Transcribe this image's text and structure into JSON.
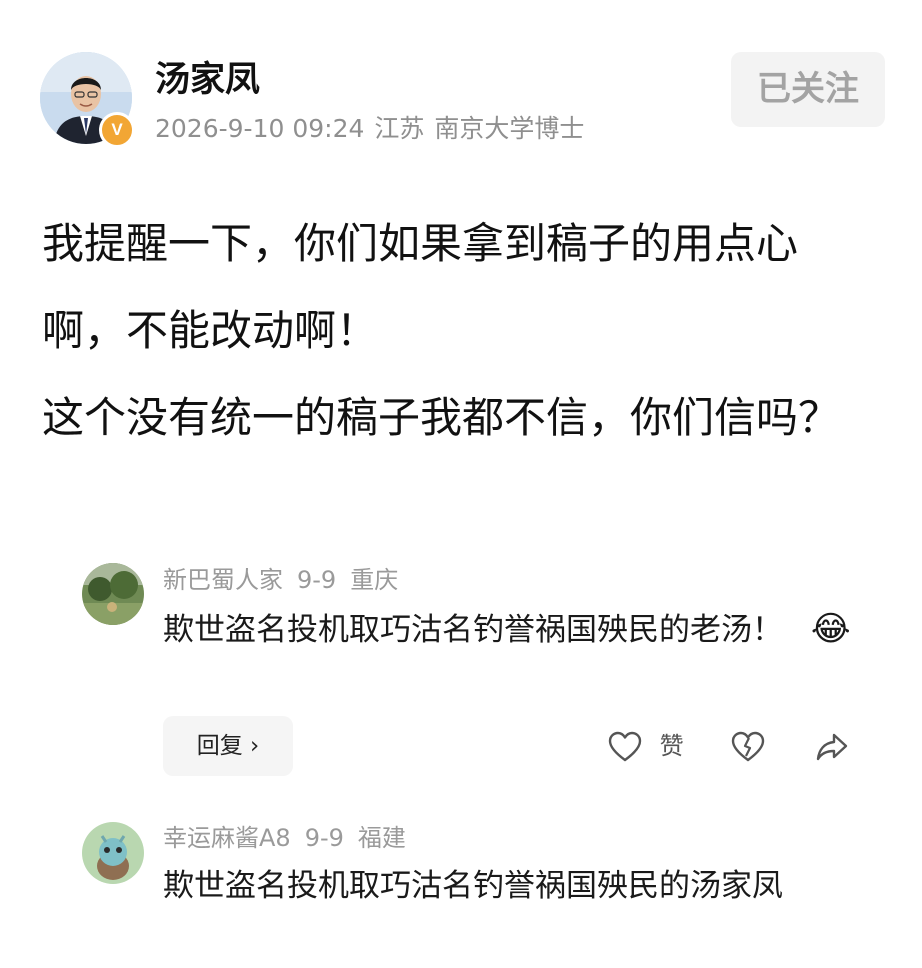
{
  "post": {
    "author": "汤家凤",
    "verified_badge": "V",
    "date": "2026-9-10 09:24",
    "location": "江苏",
    "title": "南京大学博士",
    "follow_label": "已关注",
    "paragraphs": [
      "我提醒一下，你们如果拿到稿子的用点心啊，不能改动啊！",
      "这个没有统一的稿子我都不信，你们信吗？"
    ]
  },
  "comments": [
    {
      "user": "新巴蜀人家",
      "date": "9-9",
      "location": "重庆",
      "text": "欺世盗名投机取巧沽名钓誉祸国殃民的老汤！",
      "emoji": "😂",
      "actions": {
        "reply_label": "回复 ›",
        "like_label": "赞"
      }
    },
    {
      "user": "幸运麻酱A8",
      "date": "9-9",
      "location": "福建",
      "text": "欺世盗名投机取巧沽名钓誉祸国殃民的汤家凤"
    }
  ],
  "colors": {
    "badge": "#f2a634",
    "meta_text": "#8f8f8f",
    "follow_bg": "#f3f3f3"
  }
}
